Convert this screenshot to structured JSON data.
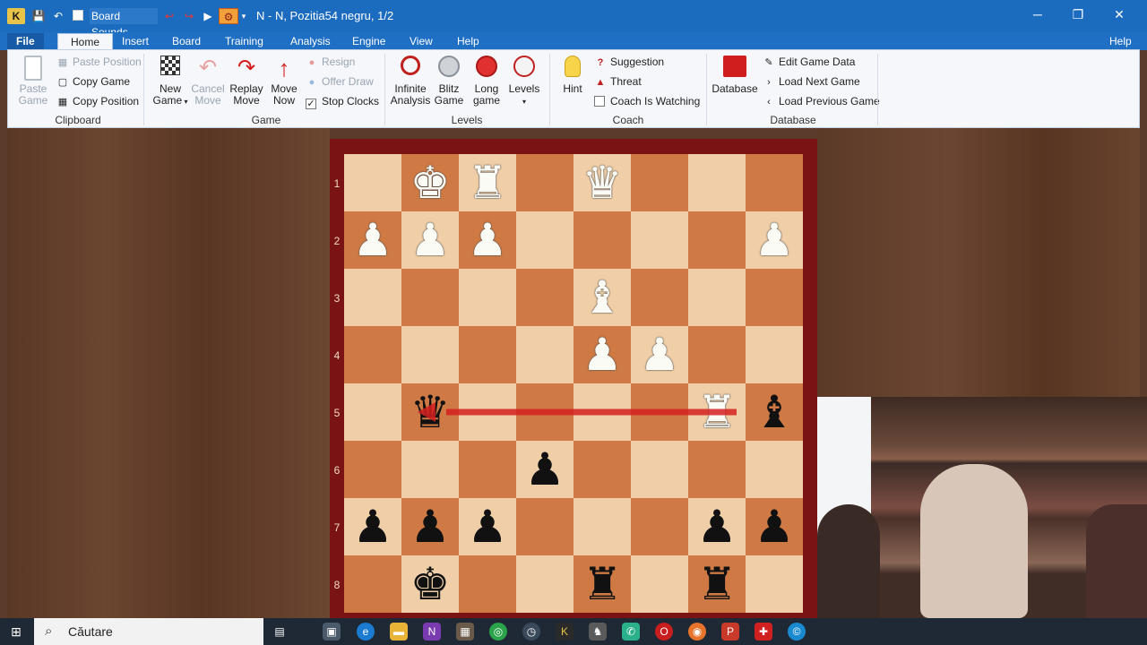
{
  "titlebar": {
    "quick_access_label": "Board Sounds",
    "title": "N - N, Pozitia54 negru, 1/2",
    "minimize": "─",
    "maximize": "❐",
    "close": "✕"
  },
  "tabs": {
    "file": "File",
    "home": "Home",
    "insert": "Insert",
    "board": "Board",
    "training": "Training",
    "analysis": "Analysis",
    "engine": "Engine",
    "view": "View",
    "help": "Help",
    "help_right": "Help"
  },
  "ribbon": {
    "clipboard": {
      "paste_game": [
        "Paste",
        "Game"
      ],
      "paste_position": "Paste Position",
      "copy_game": "Copy Game",
      "copy_position": "Copy Position",
      "group": "Clipboard"
    },
    "game": {
      "new_game": [
        "New",
        "Game"
      ],
      "cancel_move": [
        "Cancel",
        "Move"
      ],
      "replay_move": [
        "Replay",
        "Move"
      ],
      "move_now": [
        "Move",
        "Now"
      ],
      "resign": "Resign",
      "offer_draw": "Offer Draw",
      "stop_clocks": "Stop Clocks",
      "group": "Game"
    },
    "levels": {
      "infinite": [
        "Infinite",
        "Analysis"
      ],
      "blitz": [
        "Blitz",
        "Game"
      ],
      "long": [
        "Long",
        "game"
      ],
      "levels": [
        "Levels",
        ""
      ],
      "group": "Levels"
    },
    "coach": {
      "hint": "Hint",
      "suggestion": "Suggestion",
      "threat": "Threat",
      "coach_watching": "Coach Is Watching",
      "group": "Coach"
    },
    "database": {
      "database": "Database",
      "edit_game_data": "Edit Game Data",
      "load_next": "Load Next Game",
      "load_previous": "Load Previous Game",
      "group": "Database"
    }
  },
  "board": {
    "ranks": [
      "1",
      "2",
      "3",
      "4",
      "5",
      "6",
      "7",
      "8"
    ],
    "pieces": [
      {
        "sq": "b1",
        "glyph": "♚",
        "color": "w"
      },
      {
        "sq": "c1",
        "glyph": "♜",
        "color": "w"
      },
      {
        "sq": "e1",
        "glyph": "♛",
        "color": "w"
      },
      {
        "sq": "a2",
        "glyph": "♟",
        "color": "w"
      },
      {
        "sq": "b2",
        "glyph": "♟",
        "color": "w"
      },
      {
        "sq": "c2",
        "glyph": "♟",
        "color": "w"
      },
      {
        "sq": "h2",
        "glyph": "♟",
        "color": "w"
      },
      {
        "sq": "e3",
        "glyph": "♝",
        "color": "w"
      },
      {
        "sq": "e4",
        "glyph": "♟",
        "color": "w"
      },
      {
        "sq": "f4",
        "glyph": "♟",
        "color": "w"
      },
      {
        "sq": "b5",
        "glyph": "♛",
        "color": "b"
      },
      {
        "sq": "g5",
        "glyph": "♜",
        "color": "w"
      },
      {
        "sq": "h5",
        "glyph": "♝",
        "color": "b"
      },
      {
        "sq": "d6",
        "glyph": "♟",
        "color": "b"
      },
      {
        "sq": "a7",
        "glyph": "♟",
        "color": "b"
      },
      {
        "sq": "b7",
        "glyph": "♟",
        "color": "b"
      },
      {
        "sq": "c7",
        "glyph": "♟",
        "color": "b"
      },
      {
        "sq": "g7",
        "glyph": "♟",
        "color": "b"
      },
      {
        "sq": "h7",
        "glyph": "♟",
        "color": "b"
      },
      {
        "sq": "b8",
        "glyph": "♚",
        "color": "b"
      },
      {
        "sq": "e8",
        "glyph": "♜",
        "color": "b"
      },
      {
        "sq": "g8",
        "glyph": "♜",
        "color": "b"
      }
    ],
    "arrow": {
      "from": "g5",
      "to": "b5",
      "color": "#d42020"
    }
  },
  "taskbar": {
    "search_placeholder": "Căutare"
  }
}
